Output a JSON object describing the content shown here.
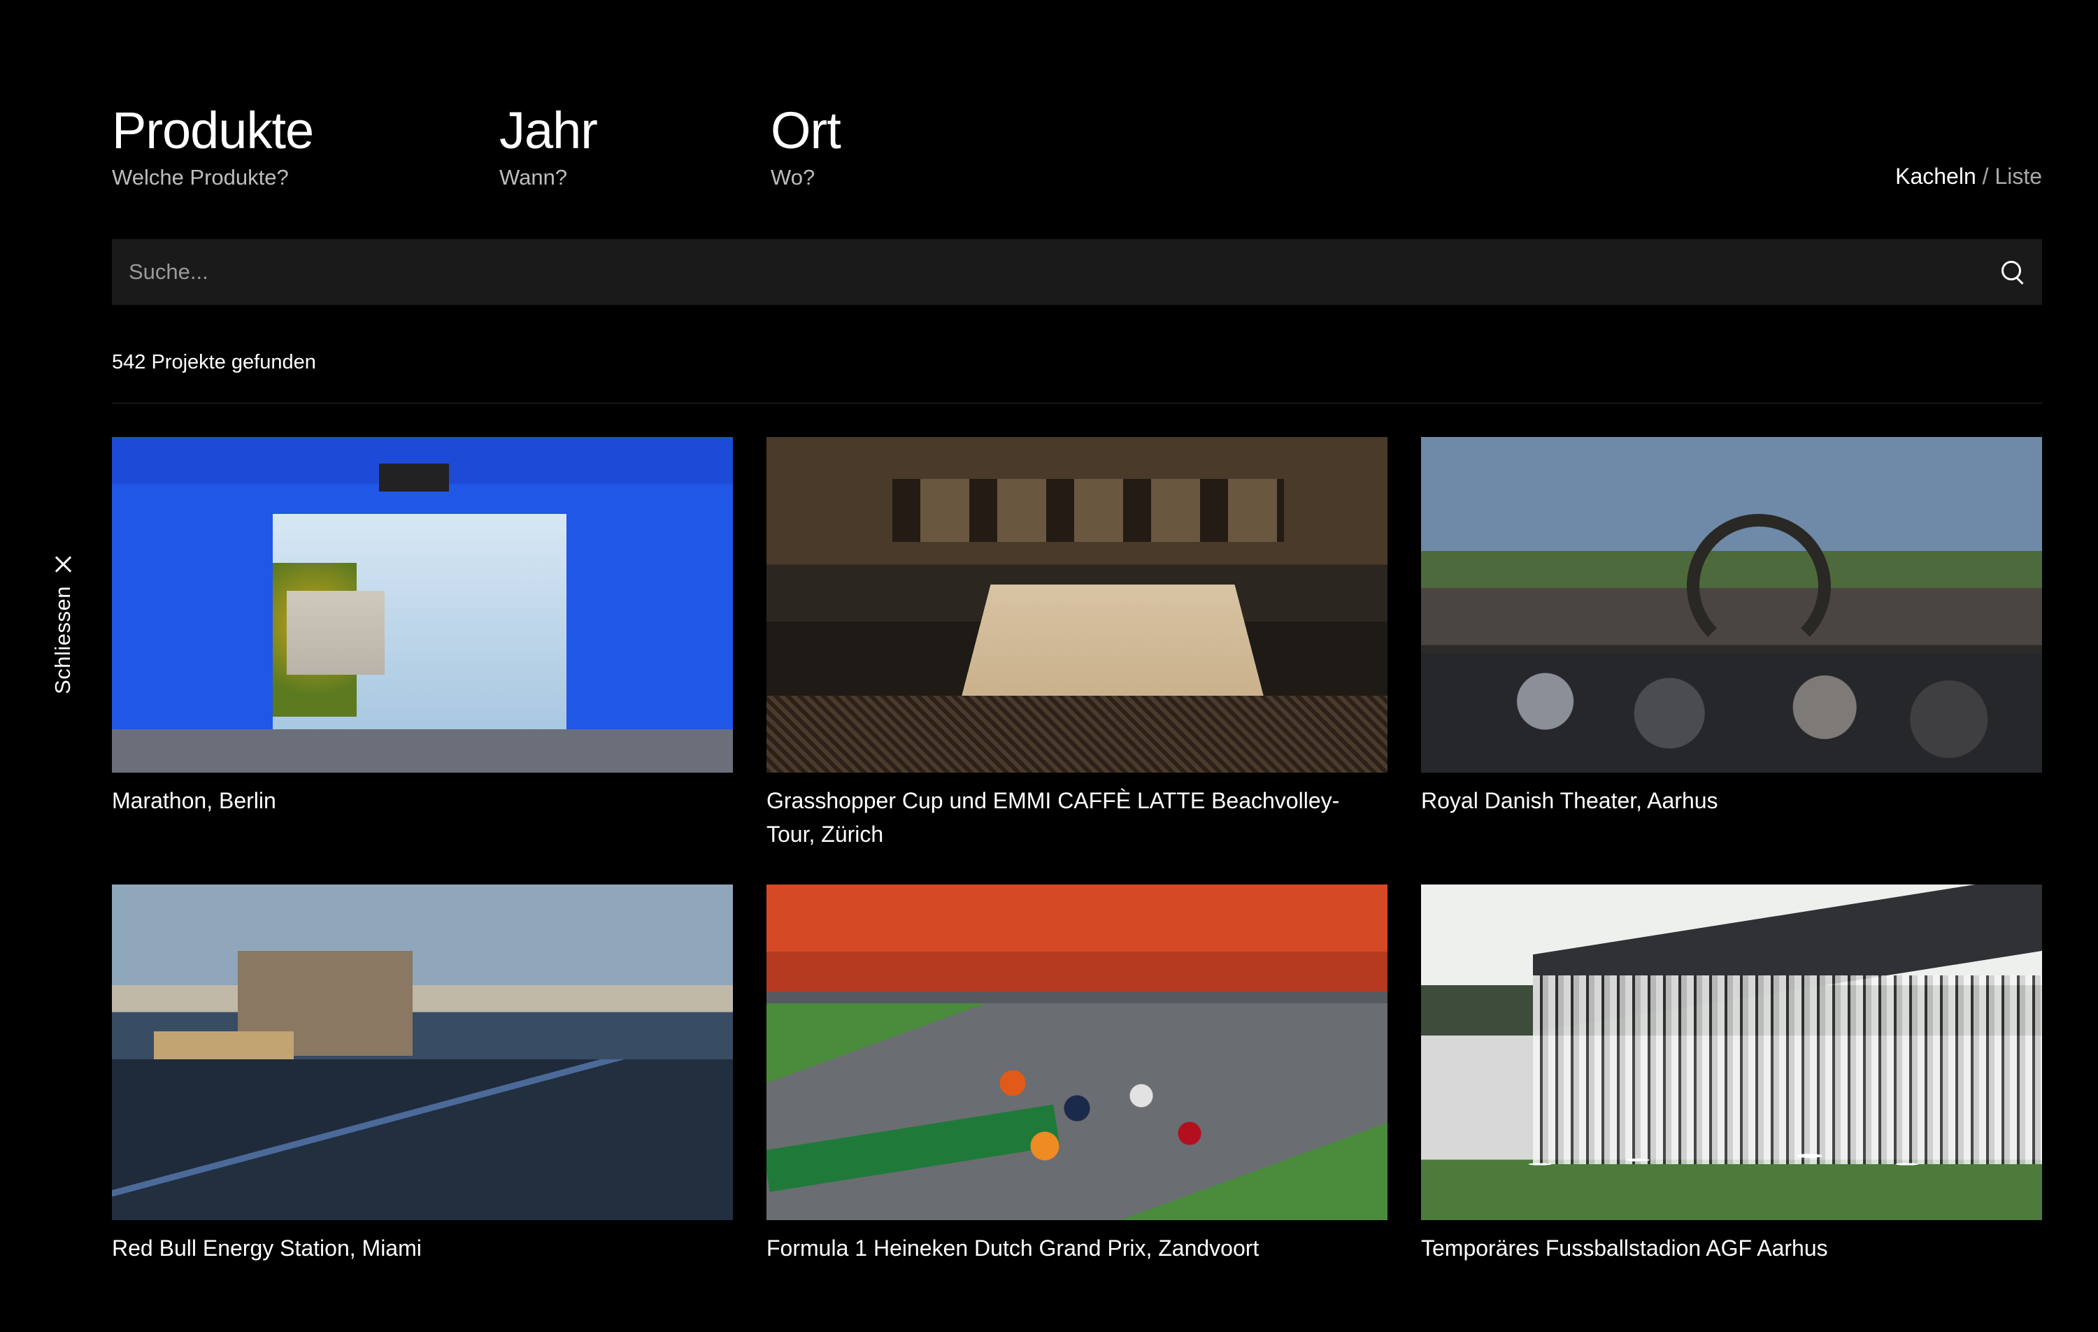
{
  "close": {
    "label": "Schliessen"
  },
  "filters": [
    {
      "title": "Produkte",
      "subtitle": "Welche Produkte?"
    },
    {
      "title": "Jahr",
      "subtitle": "Wann?"
    },
    {
      "title": "Ort",
      "subtitle": "Wo?"
    }
  ],
  "view_toggle": {
    "active": "Kacheln",
    "separator": " / ",
    "inactive": "Liste"
  },
  "search": {
    "placeholder": "Suche..."
  },
  "results": {
    "count_text": "542 Projekte gefunden"
  },
  "projects": [
    {
      "title": "Marathon, Berlin"
    },
    {
      "title": "Grasshopper Cup und EMMI CAFFÈ LATTE Beachvolley-Tour, Zürich"
    },
    {
      "title": "Royal Danish Theater, Aarhus"
    },
    {
      "title": "Red Bull Energy Station, Miami"
    },
    {
      "title": "Formula 1 Heineken Dutch Grand Prix, Zandvoort"
    },
    {
      "title": "Temporäres Fussballstadion AGF Aarhus"
    }
  ]
}
